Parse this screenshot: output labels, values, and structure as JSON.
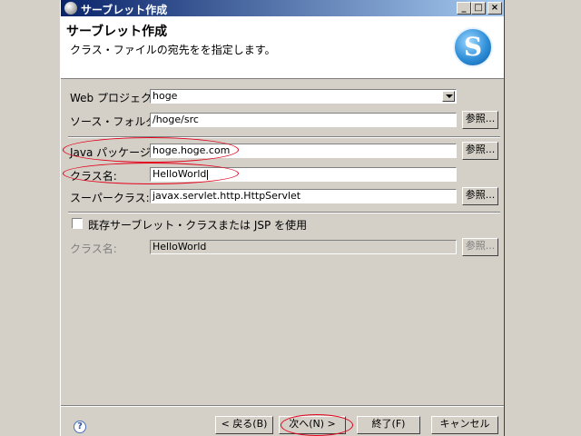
{
  "window": {
    "title": "サーブレット作成",
    "buttons": {
      "minimize": "_",
      "maximize": "□",
      "close": "×"
    }
  },
  "header": {
    "title": "サーブレット作成",
    "description": "クラス・ファイルの宛先をを指定します。",
    "logo_letter": "S"
  },
  "form": {
    "web_project": {
      "label": "Web プロジェクト:",
      "value": "hoge"
    },
    "source_folder": {
      "label": "ソース・フォルダー:",
      "value": "/hoge/src",
      "browse": "参照..."
    },
    "java_package": {
      "label": "Java パッケージ:",
      "value": "hoge.hoge.com",
      "browse": "参照..."
    },
    "class_name": {
      "label": "クラス名:",
      "value": "HelloWorld"
    },
    "superclass": {
      "label": "スーパークラス:",
      "value": "javax.servlet.http.HttpServlet",
      "browse": "参照..."
    },
    "use_existing": {
      "label": "既存サーブレット・クラスまたは JSP を使用",
      "checked": false
    },
    "existing_class": {
      "label": "クラス名:",
      "value": "HelloWorld",
      "browse": "参照..."
    }
  },
  "footer": {
    "back": "< 戻る(B)",
    "next": "次へ(N) >",
    "finish": "終了(F)",
    "cancel": "キャンセル"
  },
  "colors": {
    "titlebar_start": "#0a246a",
    "annotation": "#e3001b"
  }
}
